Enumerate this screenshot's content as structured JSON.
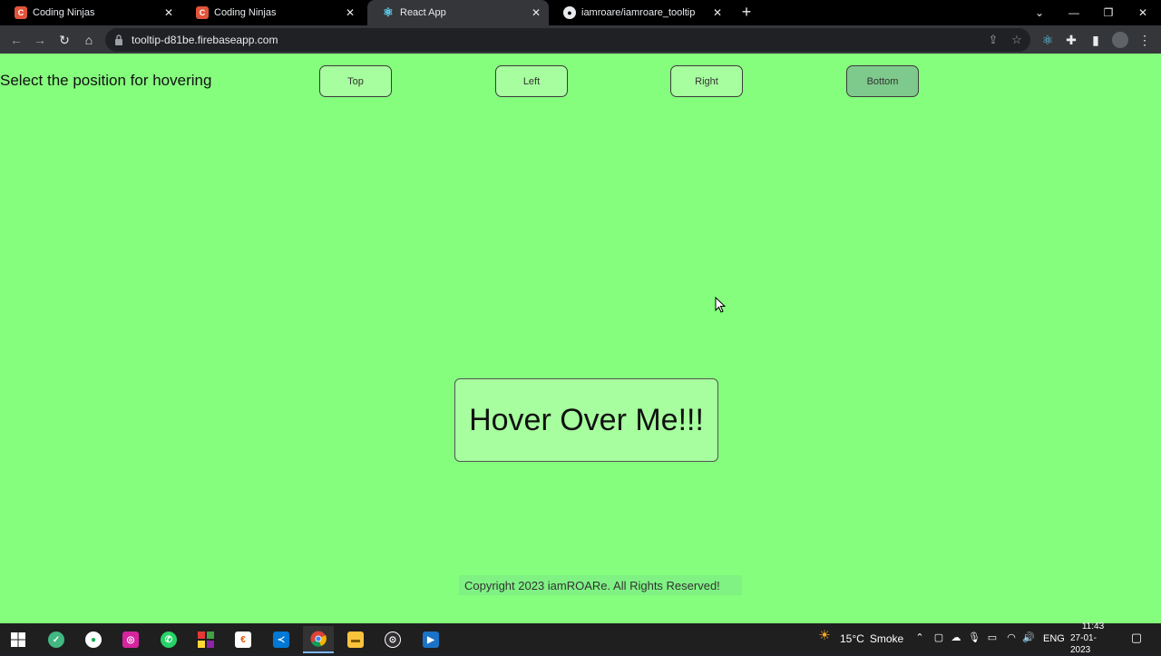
{
  "browser": {
    "tabs": [
      {
        "title": "Coding Ninjas",
        "icon": "coding-ninjas-icon",
        "active": false
      },
      {
        "title": "Coding Ninjas",
        "icon": "coding-ninjas-icon",
        "active": false
      },
      {
        "title": "React App",
        "icon": "react-icon",
        "active": true
      },
      {
        "title": "iamroare/iamroare_tooltip",
        "icon": "github-icon",
        "active": false
      }
    ],
    "close_glyph": "✕",
    "new_tab_glyph": "+",
    "url": "tooltip-d81be.firebaseapp.com"
  },
  "page": {
    "prompt": "Select the position for hovering",
    "buttons": {
      "top": "Top",
      "left": "Left",
      "right": "Right",
      "bottom": "Bottom"
    },
    "selected_position": "Bottom",
    "hover_target": "Hover Over Me!!!",
    "footer": "Copyright 2023 iamROARe. All Rights Reserved!",
    "background_color": "#85fd7d",
    "button_color": "#a6fe9e",
    "selected_button_color": "#7ec98c"
  },
  "taskbar": {
    "weather": {
      "temp": "15°C",
      "condition": "Smoke"
    },
    "language": "ENG",
    "time": "11:43",
    "date": "27-01-2023"
  }
}
